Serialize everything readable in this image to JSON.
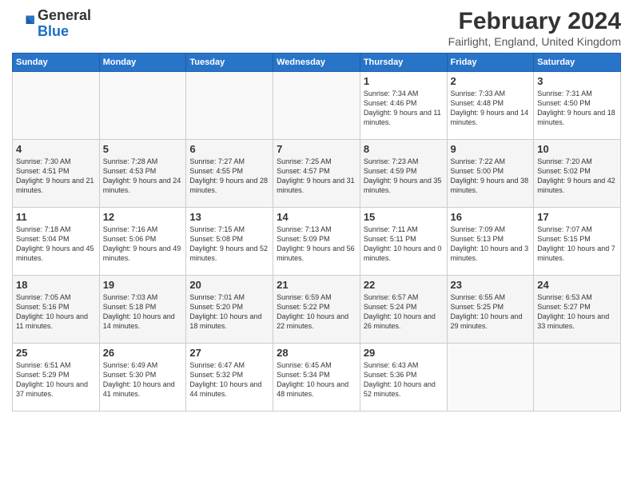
{
  "header": {
    "logo_general": "General",
    "logo_blue": "Blue",
    "month_title": "February 2024",
    "location": "Fairlight, England, United Kingdom"
  },
  "weekdays": [
    "Sunday",
    "Monday",
    "Tuesday",
    "Wednesday",
    "Thursday",
    "Friday",
    "Saturday"
  ],
  "weeks": [
    [
      {
        "day": "",
        "info": ""
      },
      {
        "day": "",
        "info": ""
      },
      {
        "day": "",
        "info": ""
      },
      {
        "day": "",
        "info": ""
      },
      {
        "day": "1",
        "info": "Sunrise: 7:34 AM\nSunset: 4:46 PM\nDaylight: 9 hours\nand 11 minutes."
      },
      {
        "day": "2",
        "info": "Sunrise: 7:33 AM\nSunset: 4:48 PM\nDaylight: 9 hours\nand 14 minutes."
      },
      {
        "day": "3",
        "info": "Sunrise: 7:31 AM\nSunset: 4:50 PM\nDaylight: 9 hours\nand 18 minutes."
      }
    ],
    [
      {
        "day": "4",
        "info": "Sunrise: 7:30 AM\nSunset: 4:51 PM\nDaylight: 9 hours\nand 21 minutes."
      },
      {
        "day": "5",
        "info": "Sunrise: 7:28 AM\nSunset: 4:53 PM\nDaylight: 9 hours\nand 24 minutes."
      },
      {
        "day": "6",
        "info": "Sunrise: 7:27 AM\nSunset: 4:55 PM\nDaylight: 9 hours\nand 28 minutes."
      },
      {
        "day": "7",
        "info": "Sunrise: 7:25 AM\nSunset: 4:57 PM\nDaylight: 9 hours\nand 31 minutes."
      },
      {
        "day": "8",
        "info": "Sunrise: 7:23 AM\nSunset: 4:59 PM\nDaylight: 9 hours\nand 35 minutes."
      },
      {
        "day": "9",
        "info": "Sunrise: 7:22 AM\nSunset: 5:00 PM\nDaylight: 9 hours\nand 38 minutes."
      },
      {
        "day": "10",
        "info": "Sunrise: 7:20 AM\nSunset: 5:02 PM\nDaylight: 9 hours\nand 42 minutes."
      }
    ],
    [
      {
        "day": "11",
        "info": "Sunrise: 7:18 AM\nSunset: 5:04 PM\nDaylight: 9 hours\nand 45 minutes."
      },
      {
        "day": "12",
        "info": "Sunrise: 7:16 AM\nSunset: 5:06 PM\nDaylight: 9 hours\nand 49 minutes."
      },
      {
        "day": "13",
        "info": "Sunrise: 7:15 AM\nSunset: 5:08 PM\nDaylight: 9 hours\nand 52 minutes."
      },
      {
        "day": "14",
        "info": "Sunrise: 7:13 AM\nSunset: 5:09 PM\nDaylight: 9 hours\nand 56 minutes."
      },
      {
        "day": "15",
        "info": "Sunrise: 7:11 AM\nSunset: 5:11 PM\nDaylight: 10 hours\nand 0 minutes."
      },
      {
        "day": "16",
        "info": "Sunrise: 7:09 AM\nSunset: 5:13 PM\nDaylight: 10 hours\nand 3 minutes."
      },
      {
        "day": "17",
        "info": "Sunrise: 7:07 AM\nSunset: 5:15 PM\nDaylight: 10 hours\nand 7 minutes."
      }
    ],
    [
      {
        "day": "18",
        "info": "Sunrise: 7:05 AM\nSunset: 5:16 PM\nDaylight: 10 hours\nand 11 minutes."
      },
      {
        "day": "19",
        "info": "Sunrise: 7:03 AM\nSunset: 5:18 PM\nDaylight: 10 hours\nand 14 minutes."
      },
      {
        "day": "20",
        "info": "Sunrise: 7:01 AM\nSunset: 5:20 PM\nDaylight: 10 hours\nand 18 minutes."
      },
      {
        "day": "21",
        "info": "Sunrise: 6:59 AM\nSunset: 5:22 PM\nDaylight: 10 hours\nand 22 minutes."
      },
      {
        "day": "22",
        "info": "Sunrise: 6:57 AM\nSunset: 5:24 PM\nDaylight: 10 hours\nand 26 minutes."
      },
      {
        "day": "23",
        "info": "Sunrise: 6:55 AM\nSunset: 5:25 PM\nDaylight: 10 hours\nand 29 minutes."
      },
      {
        "day": "24",
        "info": "Sunrise: 6:53 AM\nSunset: 5:27 PM\nDaylight: 10 hours\nand 33 minutes."
      }
    ],
    [
      {
        "day": "25",
        "info": "Sunrise: 6:51 AM\nSunset: 5:29 PM\nDaylight: 10 hours\nand 37 minutes."
      },
      {
        "day": "26",
        "info": "Sunrise: 6:49 AM\nSunset: 5:30 PM\nDaylight: 10 hours\nand 41 minutes."
      },
      {
        "day": "27",
        "info": "Sunrise: 6:47 AM\nSunset: 5:32 PM\nDaylight: 10 hours\nand 44 minutes."
      },
      {
        "day": "28",
        "info": "Sunrise: 6:45 AM\nSunset: 5:34 PM\nDaylight: 10 hours\nand 48 minutes."
      },
      {
        "day": "29",
        "info": "Sunrise: 6:43 AM\nSunset: 5:36 PM\nDaylight: 10 hours\nand 52 minutes."
      },
      {
        "day": "",
        "info": ""
      },
      {
        "day": "",
        "info": ""
      }
    ]
  ]
}
